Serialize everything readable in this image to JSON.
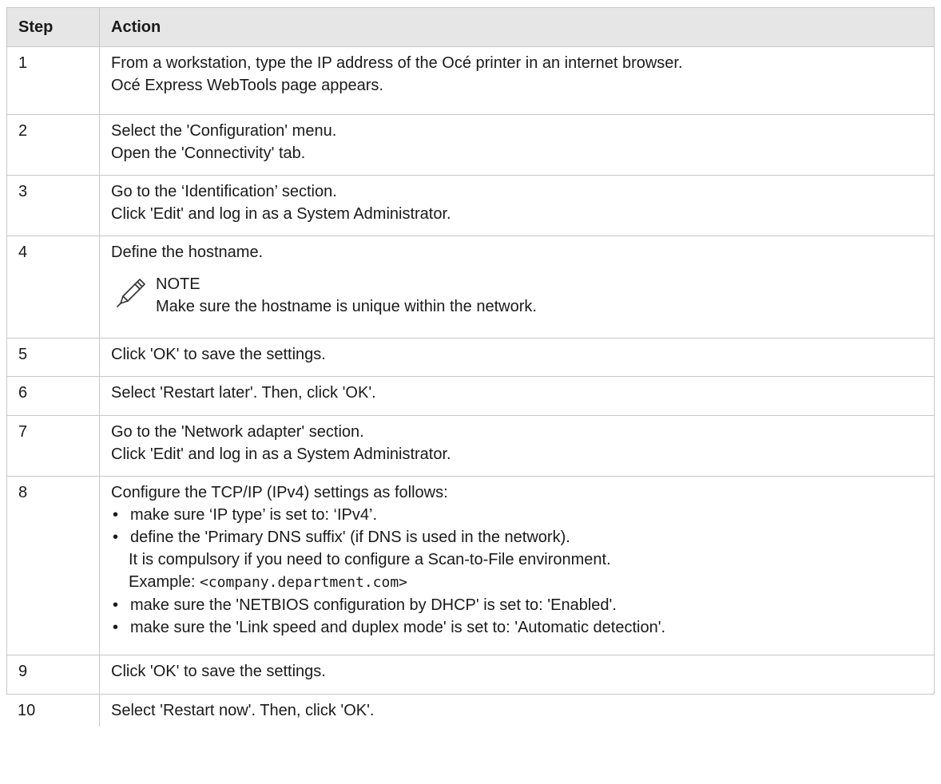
{
  "header": {
    "step": "Step",
    "action": "Action"
  },
  "rows": [
    {
      "step": "1",
      "lines": [
        "From a workstation, type the IP address of the Océ printer in an internet browser.",
        "Océ Express WebTools page appears."
      ]
    },
    {
      "step": "2",
      "lines": [
        "Select the 'Configuration' menu.",
        "Open the 'Connectivity' tab."
      ]
    },
    {
      "step": "3",
      "lines": [
        "Go to the ‘Identification’ section.",
        "Click 'Edit' and log in as a System Administrator."
      ]
    },
    {
      "step": "4",
      "lines": [
        "Define the hostname."
      ],
      "note": {
        "title": "NOTE",
        "text": "Make sure the hostname is unique within the network.",
        "icon": "pencil-icon"
      }
    },
    {
      "step": "5",
      "lines": [
        "Click 'OK' to save the settings."
      ]
    },
    {
      "step": "6",
      "lines": [
        "Select 'Restart later'. Then, click 'OK'."
      ]
    },
    {
      "step": "7",
      "lines": [
        "Go to the 'Network adapter' section.",
        "Click 'Edit' and log in as a System Administrator."
      ]
    },
    {
      "step": "8",
      "intro": "Configure the TCP/IP (IPv4) settings as follows:",
      "bullets": [
        {
          "text": "make sure ‘IP type’ is set to: ‘IPv4’."
        },
        {
          "text": "define the 'Primary DNS suffix' (if DNS is used in the network).",
          "continuation": "It is compulsory if you need to configure a Scan-to-File environment.",
          "example_label": "Example: ",
          "example_code": "<company.department.com>"
        },
        {
          "text": "make sure the 'NETBIOS configuration by DHCP' is set to: 'Enabled'."
        },
        {
          "text": "make sure the 'Link speed and duplex mode' is set to: 'Automatic detection'."
        }
      ]
    },
    {
      "step": "9",
      "lines": [
        "Click 'OK' to save the settings."
      ]
    },
    {
      "step": "10",
      "lines": [
        "Select 'Restart now'. Then, click 'OK'."
      ]
    }
  ]
}
